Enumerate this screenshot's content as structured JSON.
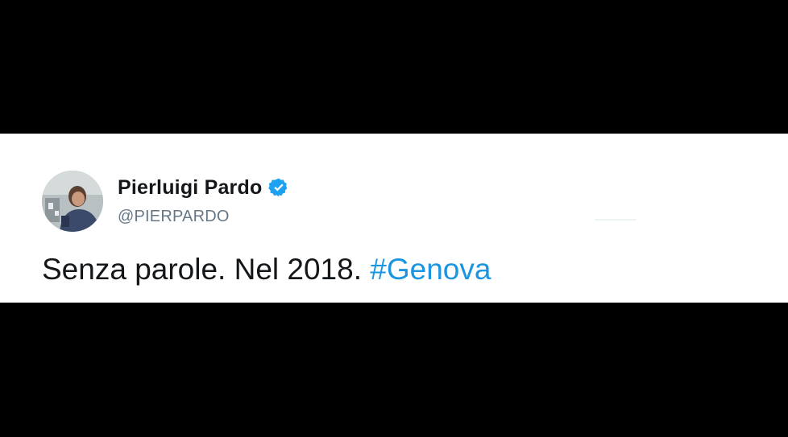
{
  "tweet": {
    "author": {
      "display_name": "Pierluigi Pardo",
      "handle": "@PIERPARDO",
      "verified": true,
      "verified_icon": "verified-badge-icon",
      "avatar": "profile-photo"
    },
    "text": {
      "body": "Senza parole. Nel 2018. ",
      "hashtag": "#Genova"
    }
  },
  "colors": {
    "background": "#000000",
    "card": "#ffffff",
    "link": "#1b95e0",
    "verified": "#1da1f2",
    "handle": "#657786",
    "text": "#14171a"
  }
}
